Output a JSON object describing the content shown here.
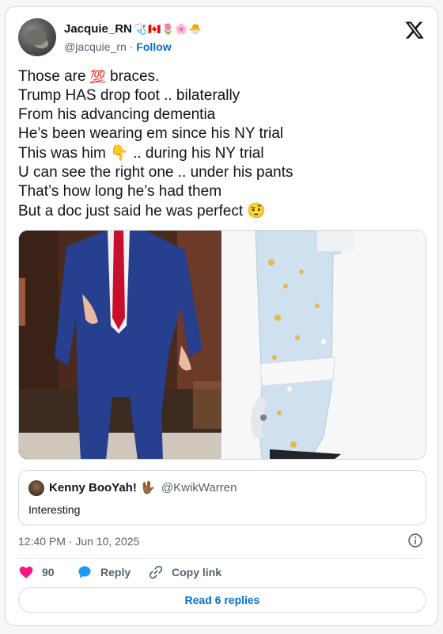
{
  "author": {
    "display_name": "Jacquie_RN",
    "name_emojis": "🩺🇨🇦🌷🌸🐣",
    "handle": "@jacquie_rn",
    "separator": "·",
    "follow_label": "Follow"
  },
  "tweet": {
    "lines": [
      {
        "before": "Those are ",
        "emoji": "💯",
        "after": " braces."
      },
      {
        "before": "Trump HAS drop foot .. bilaterally"
      },
      {
        "before": "From his advancing dementia"
      },
      {
        "before": "He’s been wearing em since his NY trial"
      },
      {
        "before": "This was him ",
        "emoji": "👇",
        "after": " .. during his NY trial"
      },
      {
        "before": "U can see the right one .. under his pants"
      },
      {
        "before": "That’s how long he’s had them"
      },
      {
        "before": "But a doc just said he was perfect ",
        "emoji": "🤨"
      }
    ]
  },
  "quote": {
    "name": "Kenny BooYah!",
    "emoji": "🖖🏾",
    "handle": "@KwikWarren",
    "text": "Interesting"
  },
  "meta": {
    "timestamp": "12:40 PM · Jun 10, 2025"
  },
  "actions": {
    "like_count": "90",
    "reply_label": "Reply",
    "copy_label": "Copy link"
  },
  "read_replies_label": "Read 6 replies",
  "colors": {
    "link": "#006fd6",
    "like": "#f91880",
    "reply": "#1d9bf0",
    "muted": "#536471"
  },
  "icons": [
    "x-logo-icon",
    "heart-icon",
    "reply-bubble-icon",
    "link-icon",
    "info-icon"
  ]
}
